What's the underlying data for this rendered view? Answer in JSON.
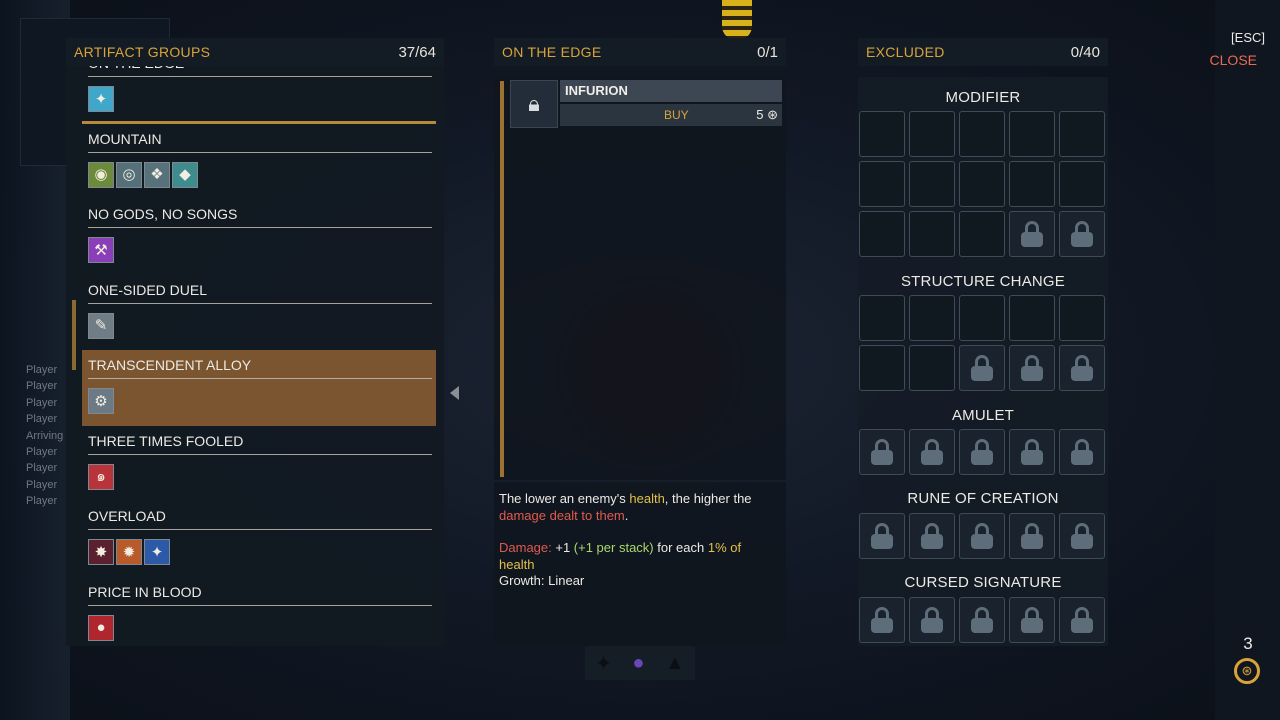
{
  "left_panel": {
    "title": "ARTIFACT GROUPS",
    "count": "37/64",
    "groups": [
      {
        "name": "ON THE EDGE",
        "icons": [
          {
            "icon": "shuriken-icon",
            "glyph": "✦",
            "color": "#3fa7c9"
          }
        ]
      },
      {
        "name": "MOUNTAIN",
        "icons": [
          {
            "icon": "golden-orb-icon",
            "glyph": "◉",
            "color": "#6b8a3a"
          },
          {
            "icon": "ring-icon",
            "glyph": "◎",
            "color": "#56707a"
          },
          {
            "icon": "scroll-icon",
            "glyph": "❖",
            "color": "#58727c"
          },
          {
            "icon": "gem-icon",
            "glyph": "◆",
            "color": "#3f8c8f"
          }
        ]
      },
      {
        "name": "NO GODS, NO SONGS",
        "icons": [
          {
            "icon": "hammer-icon",
            "glyph": "⚒",
            "color": "#8a3fb8"
          }
        ]
      },
      {
        "name": "ONE-SIDED DUEL",
        "icons": [
          {
            "icon": "dagger-icon",
            "glyph": "✎",
            "color": "#707c86"
          }
        ]
      },
      {
        "name": "TRANSCENDENT ALLOY",
        "icons": [
          {
            "icon": "wrench-icon",
            "glyph": "⚙",
            "color": "#6c7a86"
          }
        ]
      },
      {
        "name": "THREE TIMES FOOLED",
        "icons": [
          {
            "icon": "spiral-icon",
            "glyph": "๑",
            "color": "#b8343a"
          }
        ]
      },
      {
        "name": "OVERLOAD",
        "icons": [
          {
            "icon": "burst-icon",
            "glyph": "✸",
            "color": "#5a2030"
          },
          {
            "icon": "flame-gem-icon",
            "glyph": "✹",
            "color": "#b85a2a"
          },
          {
            "icon": "blue-gem-icon",
            "glyph": "✦",
            "color": "#2c5aa8"
          }
        ]
      },
      {
        "name": "PRICE IN BLOOD",
        "icons": [
          {
            "icon": "blood-drop-icon",
            "glyph": "●",
            "color": "#b0262e"
          }
        ]
      }
    ]
  },
  "middle_panel": {
    "title": "ON THE EDGE",
    "count": "0/1",
    "item": {
      "name": "INFURION",
      "buy_label": "BUY",
      "cost": "5"
    },
    "description": {
      "line1_before": "The lower an enemy's ",
      "line1_hl": "health",
      "line1_after": ", the higher the",
      "line2_hl": "damage dealt to them",
      "line2_after": ".",
      "damage_label": "Damage:",
      "damage_value": " +1 ",
      "damage_stack": "(+1 per stack)",
      "damage_for": " for each ",
      "damage_pct": "1% of",
      "damage_health": "health",
      "growth": "Growth: Linear"
    }
  },
  "right_panel": {
    "title": "EXCLUDED",
    "count": "0/40",
    "sections": [
      {
        "title": "MODIFIER",
        "open": 13,
        "locked": 2
      },
      {
        "title": "STRUCTURE CHANGE",
        "open": 7,
        "locked": 3
      },
      {
        "title": "AMULET",
        "open": 0,
        "locked": 5
      },
      {
        "title": "RUNE OF CREATION",
        "open": 0,
        "locked": 5
      },
      {
        "title": "CURSED SIGNATURE",
        "open": 0,
        "locked": 5
      }
    ]
  },
  "close": {
    "key": "[ESC]",
    "label": "CLOSE"
  },
  "currency": {
    "count": "3"
  },
  "chat_log": [
    "Player",
    "Player",
    "Player",
    "Player",
    "Arriving",
    "Player",
    "Player",
    "Player",
    "Player"
  ],
  "colors": {
    "accent": "#d9a33a",
    "selected_row": "#7a5530",
    "close": "#e86a50"
  }
}
